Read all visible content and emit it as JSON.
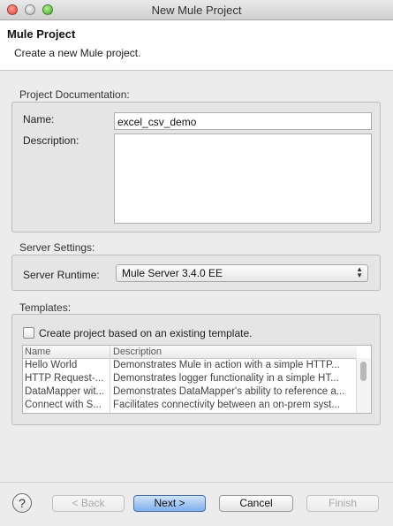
{
  "window": {
    "title": "New Mule Project"
  },
  "header": {
    "title": "Mule Project",
    "subtitle": "Create a new Mule project."
  },
  "project_documentation": {
    "section_label": "Project Documentation:",
    "name_label": "Name:",
    "name_value": "excel_csv_demo",
    "description_label": "Description:",
    "description_value": ""
  },
  "server_settings": {
    "section_label": "Server Settings:",
    "runtime_label": "Server Runtime:",
    "runtime_value": "Mule Server 3.4.0 EE"
  },
  "templates": {
    "section_label": "Templates:",
    "checkbox_label": "Create project based on an existing template.",
    "checkbox_checked": false,
    "columns": [
      "Name",
      "Description"
    ],
    "rows": [
      {
        "name": "Hello World",
        "description": "Demonstrates Mule in action with a simple HTTP..."
      },
      {
        "name": "HTTP Request-...",
        "description": "Demonstrates logger functionality in a simple HT..."
      },
      {
        "name": "DataMapper wit...",
        "description": "Demonstrates DataMapper's ability to reference a..."
      },
      {
        "name": "Connect with S...",
        "description": "Facilitates connectivity between an on-prem syst..."
      }
    ]
  },
  "footer": {
    "help_symbol": "?",
    "back_label": "< Back",
    "next_label": "Next >",
    "cancel_label": "Cancel",
    "finish_label": "Finish"
  }
}
